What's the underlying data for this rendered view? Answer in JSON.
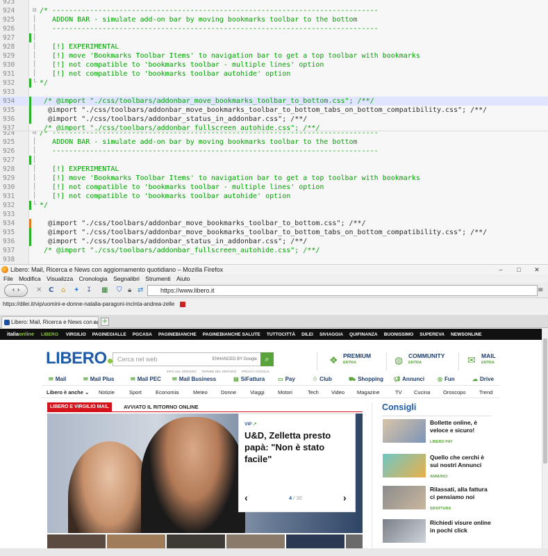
{
  "editor_top": {
    "lines": [
      {
        "n": "923",
        "mark": "",
        "fold": "",
        "hl": false,
        "text": ""
      },
      {
        "n": "924",
        "mark": "",
        "fold": "⊟",
        "hl": false,
        "text": "/* ------------------------------------------------------------------------------"
      },
      {
        "n": "925",
        "mark": "",
        "fold": "│",
        "hl": false,
        "text": "   ADDON BAR - simulate add-on bar by moving bookmarks toolbar to the bottom"
      },
      {
        "n": "926",
        "mark": "",
        "fold": "│",
        "hl": false,
        "text": "   ------------------------------------------------------------------------------"
      },
      {
        "n": "927",
        "mark": "green",
        "fold": "│",
        "hl": false,
        "text": ""
      },
      {
        "n": "928",
        "mark": "",
        "fold": "│",
        "hl": false,
        "text": "   [!] EXPERIMENTAL"
      },
      {
        "n": "929",
        "mark": "",
        "fold": "│",
        "hl": false,
        "text": "   [!] move 'Bookmarks Toolbar Items' to navigation bar to get a top toolbar with bookmarks"
      },
      {
        "n": "930",
        "mark": "",
        "fold": "│",
        "hl": false,
        "text": "   [!] not compatible to 'bookmarks toolbar - multiple lines' option"
      },
      {
        "n": "931",
        "mark": "",
        "fold": "│",
        "hl": false,
        "text": "   [!] not compatible to 'bookmarks toolbar autohide' option"
      },
      {
        "n": "932",
        "mark": "green",
        "fold": "└",
        "hl": false,
        "text": "*/"
      },
      {
        "n": "933",
        "mark": "",
        "fold": "",
        "hl": false,
        "text": ""
      },
      {
        "n": "934",
        "mark": "green",
        "fold": "",
        "hl": true,
        "text": " /* @import \"./css/toolbars/addonbar_move_bookmarks_toolbar_to_bottom.css\"; /**/"
      },
      {
        "n": "935",
        "mark": "green",
        "fold": "",
        "hl": false,
        "text": "  @import \"./css/toolbars/addonbar_move_bookmarks_toolbar_to_bottom_tabs_on_bottom_compatibility.css\"; /**/"
      },
      {
        "n": "936",
        "mark": "green",
        "fold": "",
        "hl": false,
        "text": "  @import \"./css/toolbars/addonbar_status_in_addonbar.css\"; /**/"
      },
      {
        "n": "937",
        "mark": "",
        "fold": "",
        "hl": false,
        "text": " /* @import \"./css/toolbars/addonbar_fullscreen_autohide.css\"; /**/"
      }
    ]
  },
  "editor_bottom": {
    "lines": [
      {
        "n": "924",
        "mark": "",
        "fold": "⊟",
        "hl": false,
        "text": "/* ------------------------------------------------------------------------------"
      },
      {
        "n": "925",
        "mark": "",
        "fold": "│",
        "hl": false,
        "text": "   ADDON BAR - simulate add-on bar by moving bookmarks toolbar to the bottom"
      },
      {
        "n": "926",
        "mark": "",
        "fold": "│",
        "hl": false,
        "text": "   ------------------------------------------------------------------------------"
      },
      {
        "n": "927",
        "mark": "green",
        "fold": "│",
        "hl": false,
        "text": ""
      },
      {
        "n": "928",
        "mark": "",
        "fold": "│",
        "hl": false,
        "text": "   [!] EXPERIMENTAL"
      },
      {
        "n": "929",
        "mark": "",
        "fold": "│",
        "hl": false,
        "text": "   [!] move 'Bookmarks Toolbar Items' to navigation bar to get a top toolbar with bookmarks"
      },
      {
        "n": "930",
        "mark": "",
        "fold": "│",
        "hl": false,
        "text": "   [!] not compatible to 'bookmarks toolbar - multiple lines' option"
      },
      {
        "n": "931",
        "mark": "",
        "fold": "│",
        "hl": false,
        "text": "   [!] not compatible to 'bookmarks toolbar autohide' option"
      },
      {
        "n": "932",
        "mark": "green",
        "fold": "└",
        "hl": false,
        "text": "*/"
      },
      {
        "n": "933",
        "mark": "",
        "fold": "",
        "hl": false,
        "text": ""
      },
      {
        "n": "934",
        "mark": "orange",
        "fold": "",
        "hl": false,
        "text": "  @import \"./css/toolbars/addonbar_move_bookmarks_toolbar_to_bottom.css\"; /**/"
      },
      {
        "n": "935",
        "mark": "green",
        "fold": "",
        "hl": false,
        "text": "  @import \"./css/toolbars/addonbar_move_bookmarks_toolbar_to_bottom_tabs_on_bottom_compatibility.css\"; /**/"
      },
      {
        "n": "936",
        "mark": "green",
        "fold": "",
        "hl": false,
        "text": "  @import \"./css/toolbars/addonbar_status_in_addonbar.css\"; /**/"
      },
      {
        "n": "937",
        "mark": "",
        "fold": "",
        "hl": false,
        "text": " /* @import \"./css/toolbars/addonbar_fullscreen_autohide.css\"; /**/"
      },
      {
        "n": "938",
        "mark": "",
        "fold": "",
        "hl": false,
        "text": ""
      }
    ]
  },
  "firefox": {
    "title": "Libero: Mail, Ricerca e News con aggiornamento quotidiano – Mozilla Firefox",
    "window_buttons": {
      "minimize": "–",
      "maximize": "□",
      "close": "✕"
    },
    "menu": [
      "File",
      "Modifica",
      "Visualizza",
      "Cronologia",
      "Segnalibri",
      "Strumenti",
      "Aiuto"
    ],
    "nav": {
      "back_forward": "‹ ›",
      "stop": "✕",
      "reload": "C",
      "url": "https://www.libero.it",
      "menu_button": "≡"
    },
    "status_link": "https://dilei.it/vip/uomini-e-donne-natalia-paragoni-incinta-andrea-zelle",
    "tab": {
      "label": "Libero: Mail, Ricerca e News con aggiornamento quotidiano",
      "close": "x",
      "new": "+"
    }
  },
  "page": {
    "iol_bar": {
      "logo_a": "italia",
      "logo_b": "online",
      "active": "LIBERO",
      "items": [
        "VIRGILIO",
        "PAGINEGIALLE",
        "PGCASA",
        "PAGINEBIANCHE",
        "PAGINEBIANCHE SALUTE",
        "TUTTOCITTÀ",
        "DILEI",
        "SIVIAGGIA",
        "QUIFINANZA",
        "BUONISSIMO",
        "SUPEREVA",
        "NEWSONLINE"
      ]
    },
    "logo": "LIBERO",
    "search": {
      "placeholder": "Cerca nel web",
      "google": "ENHANCED BY Google",
      "links": [
        "INFO SUL SERVIZIO",
        "TERMINI DEL SERVIZIO",
        "PRIVACY GOOGLE"
      ]
    },
    "promos": [
      {
        "title": "PREMIUM",
        "sub": "ENTRA"
      },
      {
        "title": "COMMUNITY",
        "sub": "ENTRA"
      },
      {
        "title": "MAIL",
        "sub": "ENTRA"
      }
    ],
    "services": [
      "Mail",
      "Mail Plus",
      "Mail PEC",
      "Mail Business",
      "SiFattura",
      "Pay",
      "Club",
      "Shopping",
      "Annunci",
      "Fun",
      "Drive"
    ],
    "categories": [
      "Libero è anche ⌄",
      "Notizie",
      "Sport",
      "Economia",
      "Meteo",
      "Donne",
      "Viaggi",
      "Motori",
      "Tech",
      "Video",
      "Magazine",
      "TV",
      "Cucina",
      "Oroscopo",
      "Trend"
    ],
    "hero": {
      "tag": "LIBERO E VIRGILIO MAIL",
      "subtitle": "AVVIATO IL RITORNO ONLINE",
      "card_label": "VIP",
      "headline": "U&D, Zelletta presto papà: \"Non è stato facile\"",
      "page_current": "4",
      "page_total": "/ 30",
      "prev": "‹",
      "next": "›"
    },
    "sidebar": {
      "title": "Consigli",
      "items": [
        {
          "text": "Bollette online, è veloce e sicuro!",
          "src": "LIBERO PAY"
        },
        {
          "text": "Quello che cerchi è sui nostri Annunci",
          "src": "ANNUNCI"
        },
        {
          "text": "Rilassati, alla fattura ci pensiamo noi",
          "src": "SIFATTURA"
        },
        {
          "text": "Richiedi visure online in pochi click",
          "src": ""
        }
      ]
    }
  },
  "colors": {
    "accent_green": "#5aa33b",
    "brand_blue": "#1d5aa8",
    "tag_red": "#d3121b"
  }
}
